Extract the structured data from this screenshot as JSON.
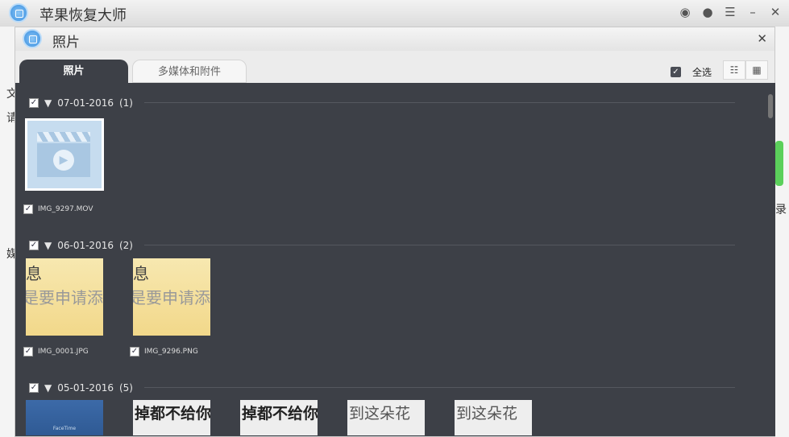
{
  "app": {
    "title": "苹果恢复大师",
    "icons": [
      "weibo-icon",
      "chat-icon",
      "feedback-icon",
      "minimize-icon",
      "close-icon"
    ]
  },
  "background_fragments": [
    "文",
    "请",
    "媒",
    "录"
  ],
  "dialog": {
    "title": "照片",
    "tabs": [
      "照片",
      "多媒体和附件"
    ],
    "select_all": "全选",
    "views": [
      "list-view-icon",
      "calendar-view-icon"
    ]
  },
  "groups": [
    {
      "date": "07-01-2016",
      "count": "(1)",
      "items": [
        {
          "name": "IMG_9297.MOV",
          "type": "video"
        }
      ]
    },
    {
      "date": "06-01-2016",
      "count": "(2)",
      "items": [
        {
          "name": "IMG_0001.JPG",
          "preview": [
            "息",
            "是要申请添"
          ]
        },
        {
          "name": "IMG_9296.PNG",
          "preview": [
            "息",
            "是要申请添"
          ]
        }
      ]
    },
    {
      "date": "05-01-2016",
      "count": "(5)",
      "items": [
        {
          "preview": [
            "FaceTime"
          ]
        },
        {
          "preview": [
            "掉都不给你"
          ]
        },
        {
          "preview": [
            "掉都不给你"
          ]
        },
        {
          "preview": [
            "到这朵花"
          ]
        },
        {
          "preview": [
            "到这朵花"
          ]
        }
      ]
    }
  ]
}
